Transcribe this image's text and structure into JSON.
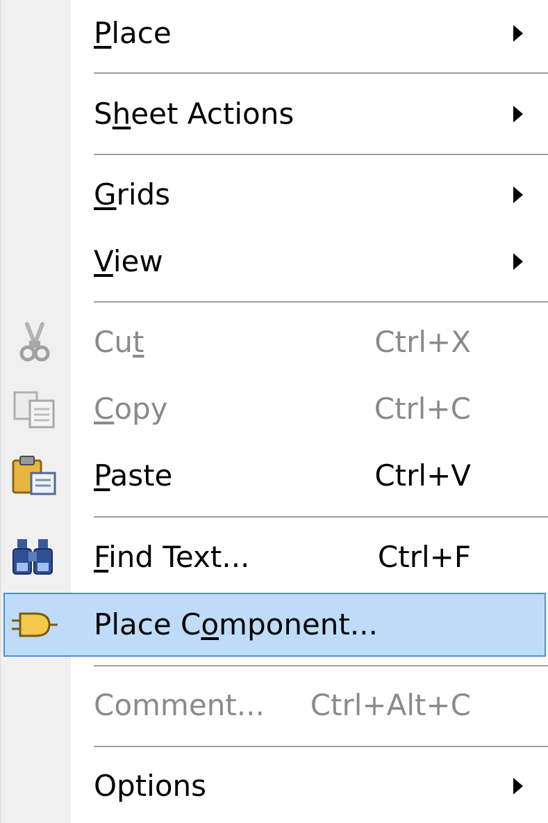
{
  "menu": {
    "items": [
      {
        "id": "place",
        "label_pre": "",
        "label_key": "P",
        "label_post": "lace",
        "shortcut": "",
        "submenu": true,
        "disabled": false
      },
      {
        "id": "sheet_actions",
        "label_pre": "S",
        "label_key": "h",
        "label_post": "eet Actions",
        "shortcut": "",
        "submenu": true,
        "disabled": false
      },
      {
        "id": "grids",
        "label_pre": "",
        "label_key": "G",
        "label_post": "rids",
        "shortcut": "",
        "submenu": true,
        "disabled": false
      },
      {
        "id": "view",
        "label_pre": "",
        "label_key": "V",
        "label_post": "iew",
        "shortcut": "",
        "submenu": true,
        "disabled": false
      },
      {
        "id": "cut",
        "label_pre": "Cu",
        "label_key": "t",
        "label_post": "",
        "shortcut": "Ctrl+X",
        "submenu": false,
        "disabled": true,
        "icon": "scissors-icon"
      },
      {
        "id": "copy",
        "label_pre": "",
        "label_key": "C",
        "label_post": "opy",
        "shortcut": "Ctrl+C",
        "submenu": false,
        "disabled": true,
        "icon": "copy-icon"
      },
      {
        "id": "paste",
        "label_pre": "",
        "label_key": "P",
        "label_post": "aste",
        "shortcut": "Ctrl+V",
        "submenu": false,
        "disabled": false,
        "icon": "clipboard-paste-icon"
      },
      {
        "id": "find_text",
        "label_pre": "",
        "label_key": "F",
        "label_post": "ind Text...",
        "shortcut": "Ctrl+F",
        "submenu": false,
        "disabled": false,
        "icon": "binoculars-icon"
      },
      {
        "id": "place_component",
        "label_pre": "Place C",
        "label_key": "o",
        "label_post": "mponent...",
        "shortcut": "",
        "submenu": false,
        "disabled": false,
        "highlighted": true,
        "icon": "component-icon"
      },
      {
        "id": "comment",
        "label_pre": "Comment...",
        "label_key": "",
        "label_post": "",
        "shortcut": "Ctrl+Alt+C",
        "submenu": false,
        "disabled": true
      },
      {
        "id": "options",
        "label_pre": "Options",
        "label_key": "",
        "label_post": "",
        "shortcut": "",
        "submenu": true,
        "disabled": false
      }
    ]
  },
  "colors": {
    "gutter": "#f0f0f0",
    "highlight_fill": "#bedcf8",
    "highlight_border": "#4a8fd8",
    "disabled_text": "#8a8a8a"
  }
}
